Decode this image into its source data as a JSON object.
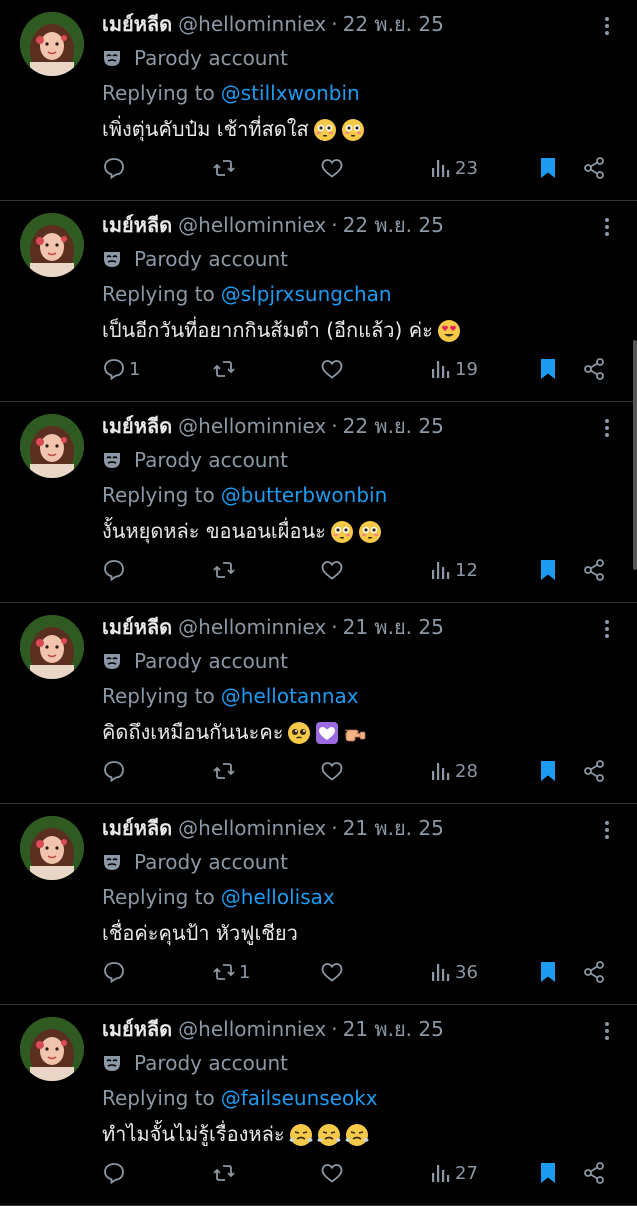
{
  "colors": {
    "background": "#000000",
    "text_primary": "#e7e9ea",
    "text_secondary": "#8b98a5",
    "link": "#1d9bf0",
    "bookmark_active": "#1d9bf0",
    "divider": "#2f3336"
  },
  "tweets": [
    {
      "display_name": "เมย์หลีด",
      "handle": "@hellominniex",
      "dot": "·",
      "date": "22 พ.ย. 25",
      "parody_label": "Parody account",
      "replying_to_label": "Replying to",
      "replying_to_handle": "@stillxwonbin",
      "text": "เพิ่งตุ่นคับป๋ม เช้าที่สดใส",
      "emojis": [
        "flushed-face-emoji",
        "flushed-face-emoji"
      ],
      "reply_count": "",
      "retweet_count": "",
      "like_count": "",
      "view_count": "23",
      "bookmarked": true
    },
    {
      "display_name": "เมย์หลีด",
      "handle": "@hellominniex",
      "dot": "·",
      "date": "22 พ.ย. 25",
      "parody_label": "Parody account",
      "replying_to_label": "Replying to",
      "replying_to_handle": "@slpjrxsungchan",
      "text": "เป็นอีกวันที่อยากกินส้มตำ (อีกแล้ว) ค่ะ",
      "emojis": [
        "heart-eyes-emoji"
      ],
      "reply_count": "1",
      "retweet_count": "",
      "like_count": "",
      "view_count": "19",
      "bookmarked": true
    },
    {
      "display_name": "เมย์หลีด",
      "handle": "@hellominniex",
      "dot": "·",
      "date": "22 พ.ย. 25",
      "parody_label": "Parody account",
      "replying_to_label": "Replying to",
      "replying_to_handle": "@butterbwonbin",
      "text": "งั้นหยุดหล่ะ ขอนอนเผื่อนะ",
      "emojis": [
        "flushed-face-emoji",
        "flushed-face-emoji"
      ],
      "reply_count": "",
      "retweet_count": "",
      "like_count": "",
      "view_count": "12",
      "bookmarked": true
    },
    {
      "display_name": "เมย์หลีด",
      "handle": "@hellominniex",
      "dot": "·",
      "date": "21 พ.ย. 25",
      "parody_label": "Parody account",
      "replying_to_label": "Replying to",
      "replying_to_handle": "@hellotannax",
      "text": "คิดถึงเหมือนกันนะคะ",
      "emojis": [
        "pleading-face-emoji",
        "purple-heart-emoji",
        "pointing-hand-emoji"
      ],
      "reply_count": "",
      "retweet_count": "",
      "like_count": "",
      "view_count": "28",
      "bookmarked": true
    },
    {
      "display_name": "เมย์หลีด",
      "handle": "@hellominniex",
      "dot": "·",
      "date": "21 พ.ย. 25",
      "parody_label": "Parody account",
      "replying_to_label": "Replying to",
      "replying_to_handle": "@hellolisax",
      "text": "เชื่อค่ะคุนป้า หัวฟูเชียว",
      "emojis": [],
      "reply_count": "",
      "retweet_count": "1",
      "like_count": "",
      "view_count": "36",
      "bookmarked": true
    },
    {
      "display_name": "เมย์หลีด",
      "handle": "@hellominniex",
      "dot": "·",
      "date": "21 พ.ย. 25",
      "parody_label": "Parody account",
      "replying_to_label": "Replying to",
      "replying_to_handle": "@failseunseokx",
      "text": "ทำไมจั้นไม่รู้เรื่องหล่ะ",
      "emojis": [
        "steam-face-emoji",
        "steam-face-emoji",
        "steam-face-emoji"
      ],
      "reply_count": "",
      "retweet_count": "",
      "like_count": "",
      "view_count": "27",
      "bookmarked": true
    }
  ]
}
